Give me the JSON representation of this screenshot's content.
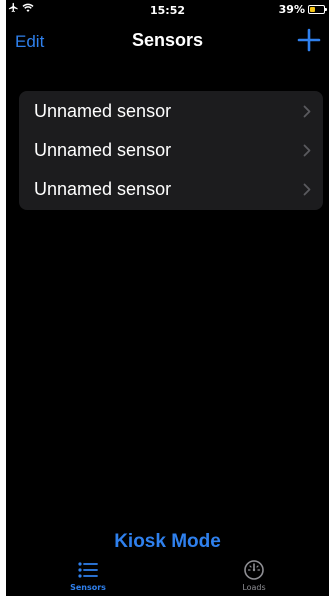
{
  "status_bar": {
    "time": "15:52",
    "battery_percent": "39%",
    "battery_level": 0.39,
    "icons": [
      "airplane-icon",
      "wifi-icon",
      "battery-charging-icon"
    ]
  },
  "nav": {
    "edit_label": "Edit",
    "title": "Sensors",
    "add_icon": "plus-icon"
  },
  "sensors": [
    {
      "label": "Unnamed sensor"
    },
    {
      "label": "Unnamed sensor"
    },
    {
      "label": "Unnamed sensor"
    }
  ],
  "kiosk_label": "Kiosk Mode",
  "tabs": [
    {
      "label": "Sensors",
      "icon": "list-icon",
      "active": true
    },
    {
      "label": "Loads",
      "icon": "gauge-icon",
      "active": false
    }
  ],
  "colors": {
    "accent": "#2f80ed",
    "background": "#000000",
    "row_background": "#1c1c1e",
    "inactive_tab": "#8e8e93",
    "battery": "#f5c518"
  }
}
